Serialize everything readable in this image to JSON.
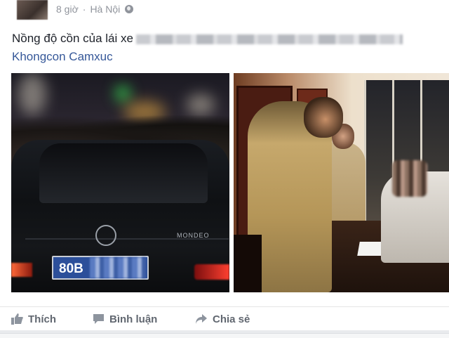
{
  "header": {
    "time": "8 giờ",
    "separator": "·",
    "location": "Hà Nội",
    "privacy_icon": "globe-icon"
  },
  "post": {
    "text": "Nồng độ cồn của lái xe",
    "author_tag": "Khongcon Camxuc"
  },
  "photos": {
    "left": {
      "plate_text": "80B",
      "car_model": "MONDEO"
    }
  },
  "actions": [
    {
      "label": "Thích",
      "icon": "thumbs-up-icon"
    },
    {
      "label": "Bình luận",
      "icon": "comment-icon"
    },
    {
      "label": "Chia sẻ",
      "icon": "share-icon"
    }
  ],
  "colors": {
    "link": "#365899",
    "meta": "#90949c",
    "action_text": "#616770",
    "plate_blue": "#2c4f9a"
  }
}
